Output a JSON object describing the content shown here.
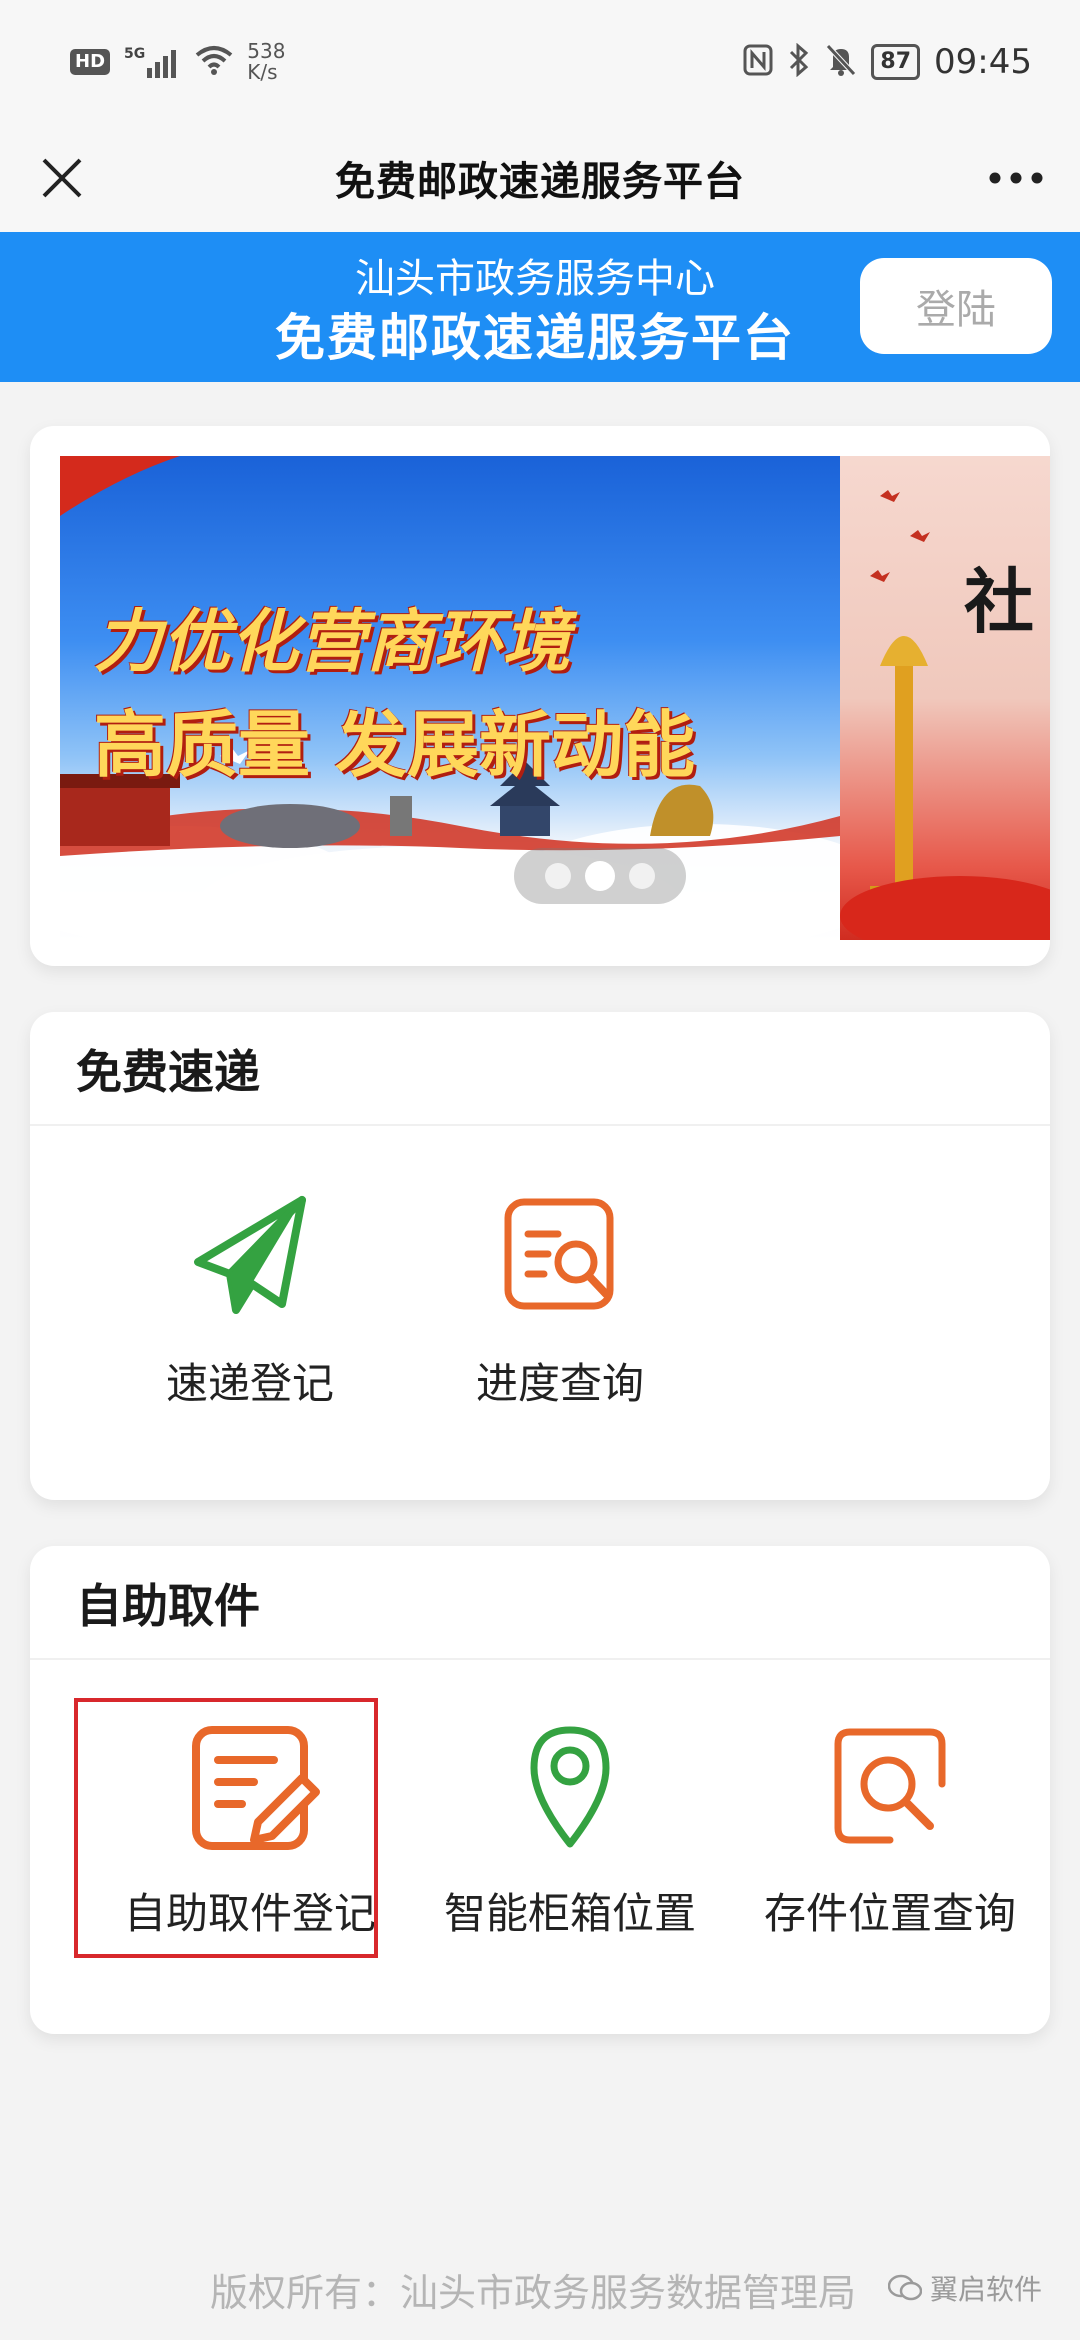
{
  "status_bar": {
    "hd": "HD",
    "signal_label": "5G",
    "speed_value": "538",
    "speed_unit": "K/s",
    "battery": "87",
    "time": "09:45"
  },
  "title_bar": {
    "title": "免费邮政速递服务平台"
  },
  "header": {
    "line1": "汕头市政务服务中心",
    "line2": "免费邮政速递服务平台",
    "login_label": "登陆"
  },
  "banner": {
    "slogan_line1": "力优化营商环境",
    "slogan_line2": "高质量  发展新动能",
    "side_text": "社",
    "active_slide": 2,
    "slide_count": 3
  },
  "free_delivery": {
    "title": "免费速递",
    "items": [
      {
        "label": "速递登记",
        "icon": "paper-plane-icon"
      },
      {
        "label": "进度查询",
        "icon": "document-search-icon"
      }
    ]
  },
  "self_pickup": {
    "title": "自助取件",
    "items": [
      {
        "label": "自助取件登记",
        "icon": "document-edit-icon",
        "highlighted": true
      },
      {
        "label": "智能柜箱位置",
        "icon": "location-pin-icon"
      },
      {
        "label": "存件位置查询",
        "icon": "search-box-icon"
      }
    ]
  },
  "footer": {
    "copyright": "版权所有：汕头市政务服务数据管理局",
    "watermark": "翼启软件"
  },
  "colors": {
    "accent_blue": "#1e8ef5",
    "icon_green": "#34a241",
    "icon_orange": "#e8682a",
    "highlight_red": "#d8282c"
  }
}
